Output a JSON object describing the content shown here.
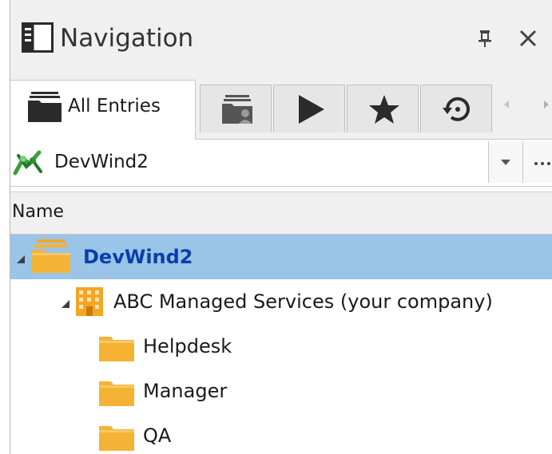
{
  "panel": {
    "title": "Navigation",
    "icons": {
      "header": "sidebar-panel-icon",
      "pin": "pin-icon",
      "close": "close-icon"
    }
  },
  "tabs": [
    {
      "label": "All Entries",
      "icon": "folder-stack-icon",
      "active": true
    },
    {
      "label": "",
      "icon": "user-folder-icon",
      "active": false
    },
    {
      "label": "",
      "icon": "play-icon",
      "active": false
    },
    {
      "label": "",
      "icon": "star-icon",
      "active": false
    },
    {
      "label": "",
      "icon": "history-icon",
      "active": false
    }
  ],
  "location": {
    "value": "DevWind2",
    "icon": "datasource-icon"
  },
  "columns": {
    "name": "Name"
  },
  "tree": [
    {
      "label": "DevWind2",
      "icon": "folder-stack-icon",
      "level": 0,
      "expanded": true,
      "selected": true
    },
    {
      "label": "ABC Managed Services (your company)",
      "icon": "building-icon",
      "level": 1,
      "expanded": true,
      "selected": false
    },
    {
      "label": "Helpdesk",
      "icon": "folder-icon",
      "level": 2,
      "selected": false
    },
    {
      "label": "Manager",
      "icon": "folder-icon",
      "level": 2,
      "selected": false
    },
    {
      "label": "QA",
      "icon": "folder-icon",
      "level": 2,
      "selected": false
    }
  ],
  "colors": {
    "selected_row": "#9ac4e8",
    "selected_text": "#0a3fa8",
    "folder": "#f5b335",
    "building": "#f5a524"
  }
}
